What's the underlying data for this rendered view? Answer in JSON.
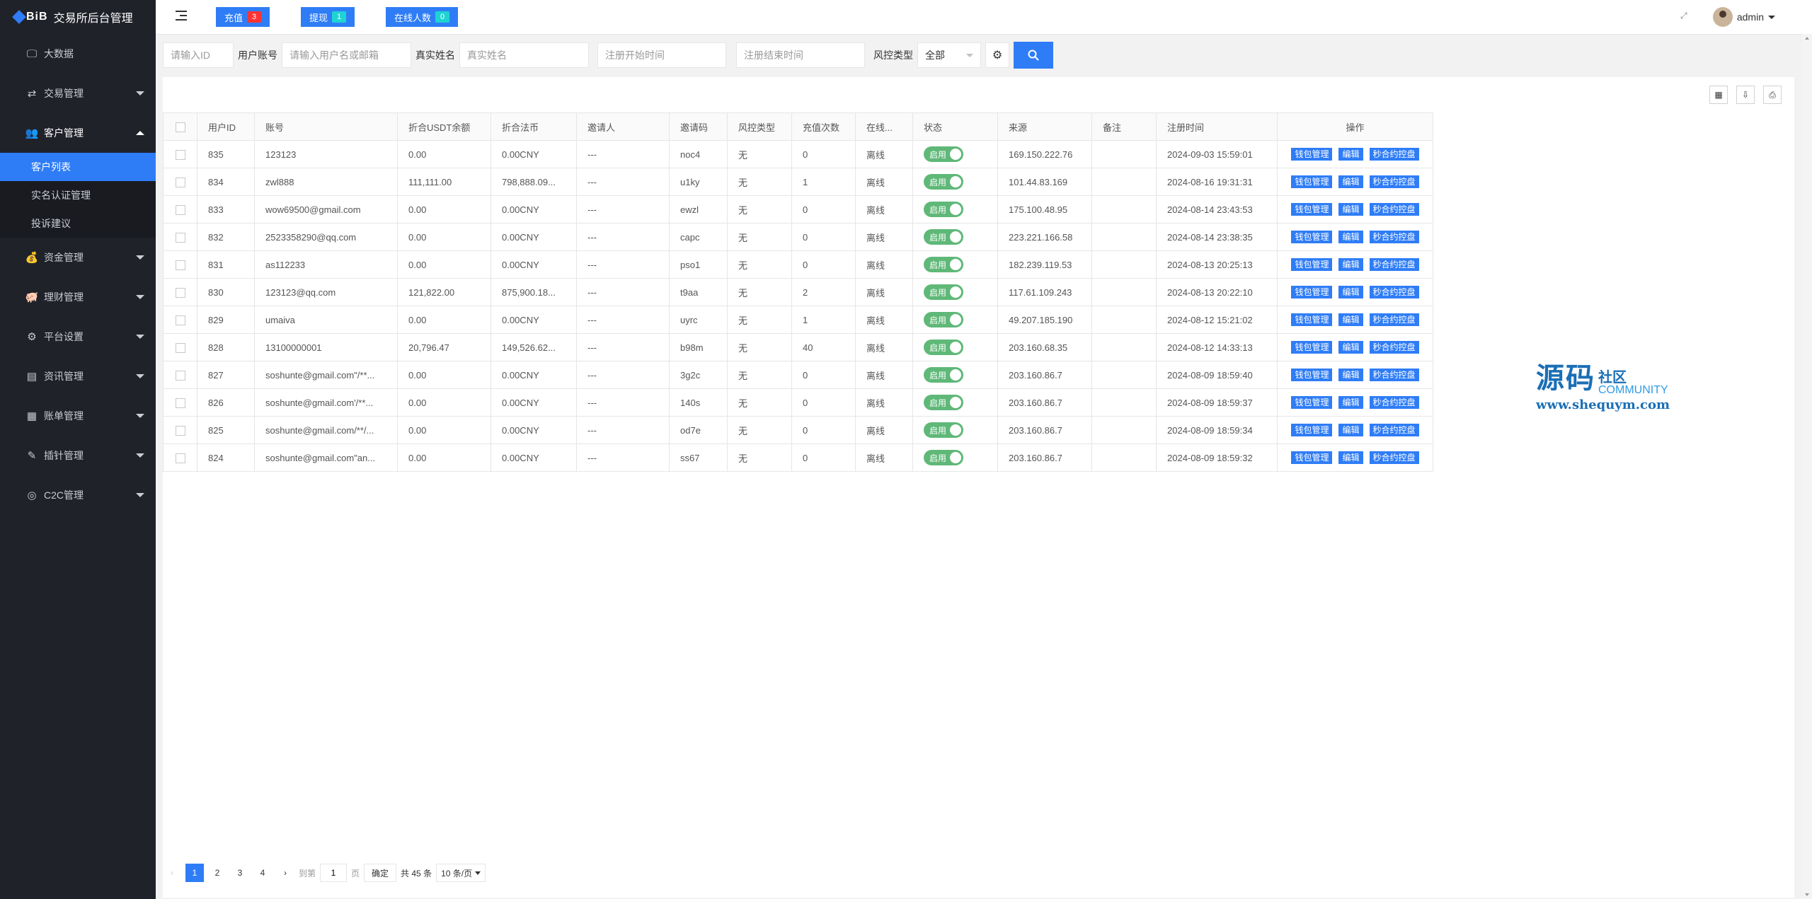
{
  "app": {
    "logo": "BiB",
    "title": "交易所后台管理"
  },
  "sidebar": {
    "items": [
      {
        "label": "大数据",
        "icon": "monitor-icon"
      },
      {
        "label": "交易管理",
        "icon": "exchange-icon"
      },
      {
        "label": "客户管理",
        "icon": "users-icon"
      },
      {
        "label": "资金管理",
        "icon": "money-bag-icon"
      },
      {
        "label": "理财管理",
        "icon": "piggy-bank-icon"
      },
      {
        "label": "平台设置",
        "icon": "settings-icon"
      },
      {
        "label": "资讯管理",
        "icon": "news-icon"
      },
      {
        "label": "账单管理",
        "icon": "bill-icon"
      },
      {
        "label": "插针管理",
        "icon": "pin-icon"
      },
      {
        "label": "C2C管理",
        "icon": "c2c-icon"
      }
    ],
    "sub_items": [
      "客户列表",
      "实名认证管理",
      "投诉建议"
    ]
  },
  "header": {
    "recharge_label": "充值",
    "recharge_count": "3",
    "withdraw_label": "提现",
    "withdraw_count": "1",
    "online_label": "在线人数",
    "online_count": "0",
    "user": "admin"
  },
  "filters": {
    "id_placeholder": "请输入ID",
    "account_label": "用户账号",
    "account_placeholder": "请输入用户名或邮箱",
    "realname_label": "真实姓名",
    "realname_placeholder": "真实姓名",
    "start_placeholder": "注册开始时间",
    "end_placeholder": "注册结束时间",
    "risk_label": "风控类型",
    "risk_value": "全部"
  },
  "table": {
    "headers": [
      "用户ID",
      "账号",
      "折合USDT余额",
      "折合法币",
      "邀请人",
      "邀请码",
      "风控类型",
      "充值次数",
      "在线...",
      "状态",
      "来源",
      "备注",
      "注册时间",
      "操作"
    ],
    "status_label": "启用",
    "ops": [
      "钱包管理",
      "编辑",
      "秒合约控盘"
    ],
    "rows": [
      [
        "835",
        "123123",
        "0.00",
        "0.00CNY",
        "---",
        "noc4",
        "无",
        "0",
        "离线",
        "169.150.222.76",
        "",
        "2024-09-03 15:59:01"
      ],
      [
        "834",
        "zwl888",
        "111,111.00",
        "798,888.09...",
        "---",
        "u1ky",
        "无",
        "1",
        "离线",
        "101.44.83.169",
        "",
        "2024-08-16 19:31:31"
      ],
      [
        "833",
        "wow69500@gmail.com",
        "0.00",
        "0.00CNY",
        "---",
        "ewzl",
        "无",
        "0",
        "离线",
        "175.100.48.95",
        "",
        "2024-08-14 23:43:53"
      ],
      [
        "832",
        "2523358290@qq.com",
        "0.00",
        "0.00CNY",
        "---",
        "capc",
        "无",
        "0",
        "离线",
        "223.221.166.58",
        "",
        "2024-08-14 23:38:35"
      ],
      [
        "831",
        "as112233",
        "0.00",
        "0.00CNY",
        "---",
        "pso1",
        "无",
        "0",
        "离线",
        "182.239.119.53",
        "",
        "2024-08-13 20:25:13"
      ],
      [
        "830",
        "123123@qq.com",
        "121,822.00",
        "875,900.18...",
        "---",
        "t9aa",
        "无",
        "2",
        "离线",
        "117.61.109.243",
        "",
        "2024-08-13 20:22:10"
      ],
      [
        "829",
        "umaiva",
        "0.00",
        "0.00CNY",
        "---",
        "uyrc",
        "无",
        "1",
        "离线",
        "49.207.185.190",
        "",
        "2024-08-12 15:21:02"
      ],
      [
        "828",
        "13100000001",
        "20,796.47",
        "149,526.62...",
        "---",
        "b98m",
        "无",
        "40",
        "离线",
        "203.160.68.35",
        "",
        "2024-08-12 14:33:13"
      ],
      [
        "827",
        "soshunte@gmail.com\"/**...",
        "0.00",
        "0.00CNY",
        "---",
        "3g2c",
        "无",
        "0",
        "离线",
        "203.160.86.7",
        "",
        "2024-08-09 18:59:40"
      ],
      [
        "826",
        "soshunte@gmail.com'/**...",
        "0.00",
        "0.00CNY",
        "---",
        "140s",
        "无",
        "0",
        "离线",
        "203.160.86.7",
        "",
        "2024-08-09 18:59:37"
      ],
      [
        "825",
        "soshunte@gmail.com/**/...",
        "0.00",
        "0.00CNY",
        "---",
        "od7e",
        "无",
        "0",
        "离线",
        "203.160.86.7",
        "",
        "2024-08-09 18:59:34"
      ],
      [
        "824",
        "soshunte@gmail.com\"an...",
        "0.00",
        "0.00CNY",
        "---",
        "ss67",
        "无",
        "0",
        "离线",
        "203.160.86.7",
        "",
        "2024-08-09 18:59:32"
      ]
    ]
  },
  "pager": {
    "pages": [
      "1",
      "2",
      "3",
      "4"
    ],
    "goto_label": "到第",
    "goto_value": "1",
    "page_unit": "页",
    "confirm": "确定",
    "total": "共 45 条",
    "size": "10 条/页"
  },
  "watermark": {
    "cn": "源码",
    "cn_small": "社区",
    "en": "COMMUNITY",
    "url": "www.shequym.com"
  },
  "colors": {
    "primary": "#2f7df6",
    "sidebar": "#20222a",
    "switch_on": "#5fb878",
    "badge_red": "#ff3333",
    "badge_cyan": "#1fd3d3"
  }
}
